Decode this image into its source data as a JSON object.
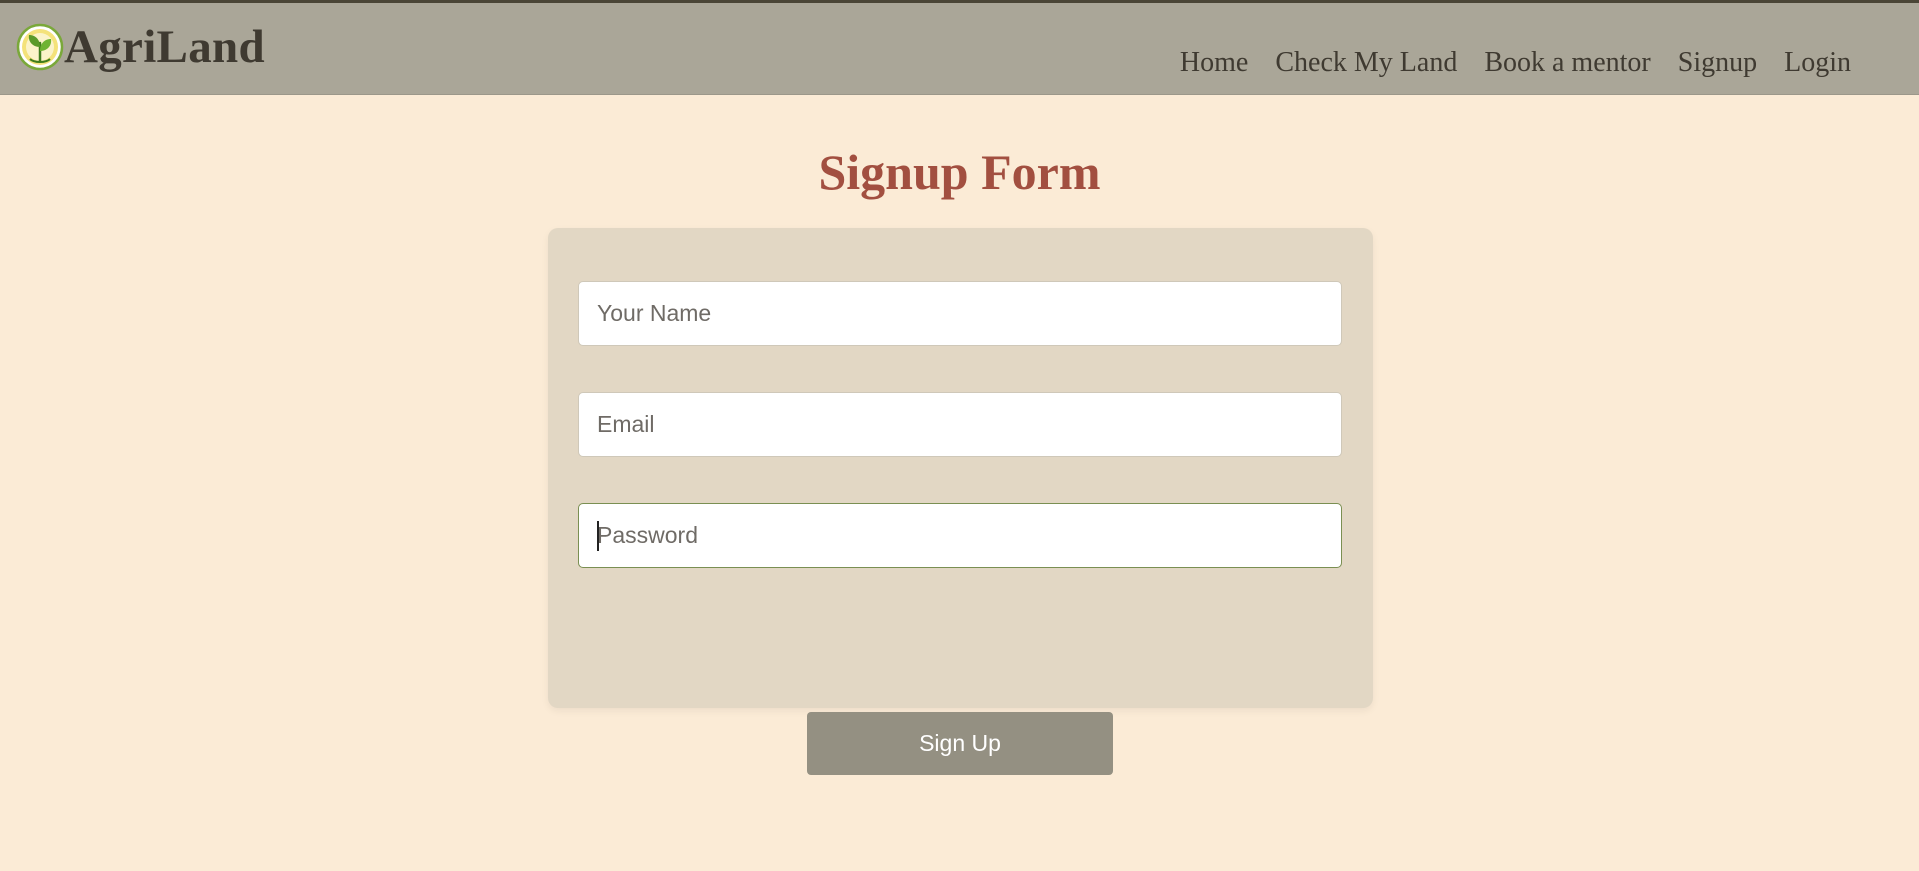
{
  "brand": {
    "name": "AgriLand",
    "logo_icon": "sprout-leaf-icon",
    "colors": {
      "leaf": "#5a9a2a",
      "ring": "#f0d84a"
    }
  },
  "nav": {
    "items": [
      {
        "label": "Home"
      },
      {
        "label": "Check My Land"
      },
      {
        "label": "Book a mentor"
      },
      {
        "label": "Signup"
      },
      {
        "label": "Login"
      }
    ]
  },
  "form": {
    "title": "Signup Form",
    "name_placeholder": "Your Name",
    "email_placeholder": "Email",
    "password_placeholder": "Password",
    "submit_label": "Sign Up"
  },
  "colors": {
    "page_bg": "#fbebd6",
    "navbar_bg": "#aaa698",
    "title": "#a24f40",
    "card_bg": "#e2d7c4",
    "button_bg": "#949082"
  }
}
